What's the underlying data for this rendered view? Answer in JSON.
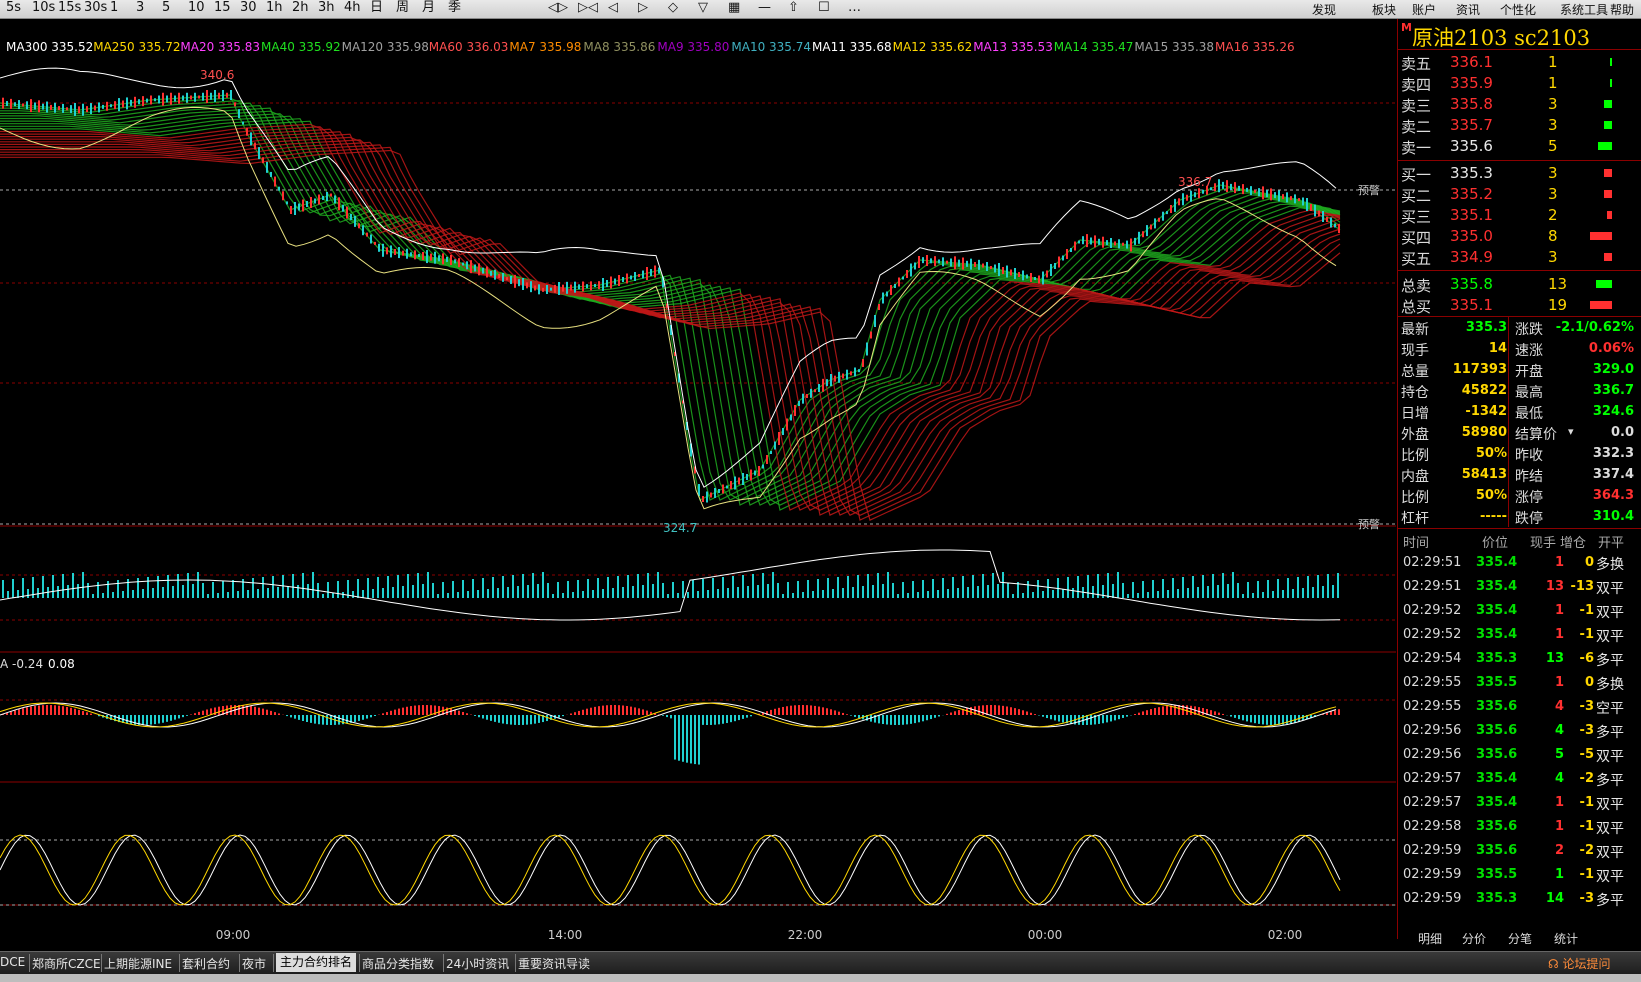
{
  "toolbar": {
    "period_buttons": [
      "5s",
      "10s",
      "15s",
      "30s",
      "1",
      "3",
      "5",
      "10",
      "15",
      "30",
      "1h",
      "2h",
      "3h",
      "4h",
      "日",
      "周",
      "月",
      "季"
    ],
    "right_menu": [
      "发现",
      "板块",
      "账户",
      "资讯",
      "个性化",
      "系统工具",
      "帮助"
    ],
    "more": "…"
  },
  "ma_legend": [
    {
      "text": "MA300 335.52",
      "color": "#ffffff"
    },
    {
      "text": "MA250 335.72",
      "color": "#ffd700"
    },
    {
      "text": "MA20 335.83",
      "color": "#ff40ff"
    },
    {
      "text": "MA40 335.92",
      "color": "#20e020"
    },
    {
      "text": "MA120 335.98",
      "color": "#a0a0a0"
    },
    {
      "text": "MA60 336.03",
      "color": "#ff5050"
    },
    {
      "text": "MA7 335.98",
      "color": "#ff8c00"
    },
    {
      "text": "MA8 335.86",
      "color": "#909060"
    },
    {
      "text": "MA9 335.80",
      "color": "#a000c0"
    },
    {
      "text": "MA10 335.74",
      "color": "#40b0c0"
    },
    {
      "text": "MA11 335.68",
      "color": "#ffffff"
    },
    {
      "text": "MA12 335.62",
      "color": "#ffd700"
    },
    {
      "text": "MA13 335.53",
      "color": "#ff40ff"
    },
    {
      "text": "MA14 335.47",
      "color": "#20e020"
    },
    {
      "text": "MA15 335.38",
      "color": "#a0a0a0"
    },
    {
      "text": "MA16 335.26",
      "color": "#ff5050"
    }
  ],
  "chart_labels": {
    "high_label": "340.6",
    "low_label": "324.7",
    "right_high_label": "336.7",
    "alert_top": "预警",
    "alert_bottom": "预警",
    "indicator_legend_a": "A -0.24",
    "indicator_legend_b": "0.08"
  },
  "time_axis": [
    "09:00",
    "14:00",
    "22:00",
    "00:00",
    "02:00"
  ],
  "panel": {
    "badge": "M",
    "title": "原油2103  sc2103",
    "asks": [
      {
        "label": "卖五",
        "price": "336.1",
        "vol": "1",
        "bar": 2
      },
      {
        "label": "卖四",
        "price": "335.9",
        "vol": "1",
        "bar": 2
      },
      {
        "label": "卖三",
        "price": "335.8",
        "vol": "3",
        "bar": 8
      },
      {
        "label": "卖二",
        "price": "335.7",
        "vol": "3",
        "bar": 8
      },
      {
        "label": "卖一",
        "price": "335.6",
        "vol": "5",
        "bar": 14
      }
    ],
    "bids": [
      {
        "label": "买一",
        "price": "335.3",
        "vol": "3",
        "bar": 8
      },
      {
        "label": "买二",
        "price": "335.2",
        "vol": "3",
        "bar": 8
      },
      {
        "label": "买三",
        "price": "335.1",
        "vol": "2",
        "bar": 5
      },
      {
        "label": "买四",
        "price": "335.0",
        "vol": "8",
        "bar": 22
      },
      {
        "label": "买五",
        "price": "334.9",
        "vol": "3",
        "bar": 8
      }
    ],
    "totals": [
      {
        "label": "总卖",
        "price": "335.8",
        "vol": "13",
        "bar": 16,
        "color": "#00ff00"
      },
      {
        "label": "总买",
        "price": "335.1",
        "vol": "19",
        "bar": 22,
        "color": "#ff3030"
      }
    ],
    "stats": [
      {
        "l1": "最新",
        "v1": "335.3",
        "c1": "#00ff00",
        "l2": "涨跌",
        "v2": "-2.1/0.62%",
        "c2": "#00ff00"
      },
      {
        "l1": "现手",
        "v1": "14",
        "c1": "#ffd700",
        "l2": "速涨",
        "v2": "0.06%",
        "c2": "#ff3030"
      },
      {
        "l1": "总量",
        "v1": "117393",
        "c1": "#ffd700",
        "l2": "开盘",
        "v2": "329.0",
        "c2": "#00ff00"
      },
      {
        "l1": "持仓",
        "v1": "45822",
        "c1": "#ffd700",
        "l2": "最高",
        "v2": "336.7",
        "c2": "#00ff00"
      },
      {
        "l1": "日增",
        "v1": "-1342",
        "c1": "#ffd700",
        "l2": "最低",
        "v2": "324.6",
        "c2": "#00ff00"
      },
      {
        "l1": "外盘",
        "v1": "58980",
        "c1": "#ffd700",
        "l2": "结算价",
        "v2": "0.0",
        "c2": "#dcdcdc"
      },
      {
        "l1": "比例",
        "v1": "50%",
        "c1": "#ffd700",
        "l2": "昨收",
        "v2": "332.3",
        "c2": "#dcdcdc"
      },
      {
        "l1": "内盘",
        "v1": "58413",
        "c1": "#ffd700",
        "l2": "昨结",
        "v2": "337.4",
        "c2": "#dcdcdc"
      },
      {
        "l1": "比例",
        "v1": "50%",
        "c1": "#ffd700",
        "l2": "涨停",
        "v2": "364.3",
        "c2": "#ff3030"
      },
      {
        "l1": "杠杆",
        "v1": "-----",
        "c1": "#ffd700",
        "l2": "跌停",
        "v2": "310.4",
        "c2": "#00ff00"
      }
    ],
    "ticks_header": [
      "时间",
      "价位",
      "现手",
      "增仓",
      "开平"
    ],
    "ticks": [
      {
        "time": "02:29:51",
        "price": "335.4",
        "vol": "1",
        "chg": "0",
        "type": "多换",
        "vc": "#ff3030"
      },
      {
        "time": "02:29:51",
        "price": "335.4",
        "vol": "13",
        "chg": "-13",
        "type": "双平",
        "vc": "#ff3030"
      },
      {
        "time": "02:29:52",
        "price": "335.4",
        "vol": "1",
        "chg": "-1",
        "type": "双平",
        "vc": "#ff3030"
      },
      {
        "time": "02:29:52",
        "price": "335.4",
        "vol": "1",
        "chg": "-1",
        "type": "双平",
        "vc": "#ff3030"
      },
      {
        "time": "02:29:54",
        "price": "335.3",
        "vol": "13",
        "chg": "-6",
        "type": "多平",
        "vc": "#00ff00"
      },
      {
        "time": "02:29:55",
        "price": "335.5",
        "vol": "1",
        "chg": "0",
        "type": "多换",
        "vc": "#ff3030"
      },
      {
        "time": "02:29:55",
        "price": "335.6",
        "vol": "4",
        "chg": "-3",
        "type": "空平",
        "vc": "#ff3030"
      },
      {
        "time": "02:29:56",
        "price": "335.6",
        "vol": "4",
        "chg": "-3",
        "type": "多平",
        "vc": "#00ff00"
      },
      {
        "time": "02:29:56",
        "price": "335.6",
        "vol": "5",
        "chg": "-5",
        "type": "双平",
        "vc": "#00ff00"
      },
      {
        "time": "02:29:57",
        "price": "335.4",
        "vol": "4",
        "chg": "-2",
        "type": "多平",
        "vc": "#00ff00"
      },
      {
        "time": "02:29:57",
        "price": "335.4",
        "vol": "1",
        "chg": "-1",
        "type": "双平",
        "vc": "#ff3030"
      },
      {
        "time": "02:29:58",
        "price": "335.6",
        "vol": "1",
        "chg": "-1",
        "type": "双平",
        "vc": "#ff3030"
      },
      {
        "time": "02:29:59",
        "price": "335.6",
        "vol": "2",
        "chg": "-2",
        "type": "双平",
        "vc": "#ff3030"
      },
      {
        "time": "02:29:59",
        "price": "335.5",
        "vol": "1",
        "chg": "-1",
        "type": "双平",
        "vc": "#00ff00"
      },
      {
        "time": "02:29:59",
        "price": "335.3",
        "vol": "14",
        "chg": "-3",
        "type": "多平",
        "vc": "#00ff00"
      }
    ],
    "tabs": [
      "明细",
      "分价",
      "分笔",
      "统计"
    ]
  },
  "statusbar": {
    "tabs": [
      "DCE",
      "郑商所CZCE",
      "上期能源INE",
      "套利合约",
      "夜市",
      "主力合约排名",
      "商品分类指数",
      "24小时资讯",
      "重要资讯导读"
    ],
    "active_index": 5,
    "right_link": "论坛提问"
  }
}
